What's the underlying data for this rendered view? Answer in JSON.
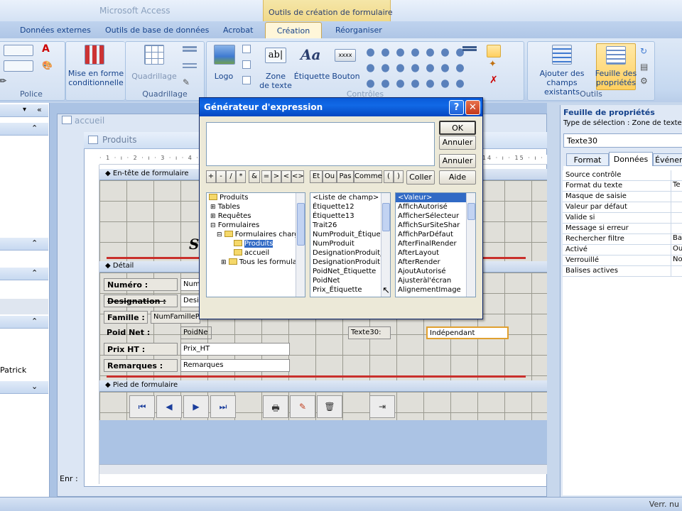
{
  "app": {
    "title": "Microsoft Access",
    "contextual_group": "Outils de création de formulaire"
  },
  "ribbon": {
    "tabs": [
      "Données externes",
      "Outils de base de données",
      "Acrobat",
      "Création",
      "Réorganiser"
    ],
    "active_tab": "Création",
    "groups": {
      "police": "Police",
      "mise_en_forme": "Mise en forme\nconditionnelle",
      "quadrillage_btn": "Quadrillage",
      "quadrillage": "Quadrillage",
      "logo": "Logo",
      "zone_de_texte": "Zone\nde texte",
      "etiquette": "Étiquette",
      "bouton": "Bouton",
      "controles": "Contrôles",
      "ajouter_champs": "Ajouter des\nchamps existants",
      "feuille_proprietes": "Feuille des\npropriétés",
      "outils": "Outils"
    }
  },
  "navpane": {
    "item_patrick": "Patrick"
  },
  "tabs": {
    "accueil": "accueil",
    "produits": "Produits"
  },
  "form": {
    "ruler": "· 1 · ı · 2 · ı · 3 · ı · 4 · ı · 5 · ı · 6 · ı · 7 · ı · 8 · ı · 9 · ı · 10 · ı · 11 · ı · 12 · ı · 13 · ı · 14 · ı · 15 · ı · 16 · ı",
    "sections": {
      "header": "En-tête de formulaire",
      "detail": "Détail",
      "footer": "Pied de formulaire"
    },
    "fields": [
      {
        "label": "Numéro :",
        "control": "Num"
      },
      {
        "label": "Designation :",
        "control": "Desi"
      },
      {
        "label": "Famille :",
        "control": "NumFamilleP"
      },
      {
        "label": "Poid Net :",
        "control": "PoidNe"
      },
      {
        "label": "Prix HT :",
        "control": "Prix_HT"
      },
      {
        "label": "Remarques :",
        "control": "Remarques"
      }
    ],
    "texte30_label": "Texte30:",
    "independant": "Indépendant",
    "nav_buttons": [
      "⏮",
      "◀",
      "▶",
      "⏭"
    ]
  },
  "dialog": {
    "title": "Générateur d'expression",
    "expression": "",
    "buttons": {
      "ok": "OK",
      "annuler1": "Annuler",
      "annuler2": "Annuler",
      "coller": "Coller",
      "aide": "Aide"
    },
    "operators": [
      "+",
      "-",
      "/",
      "*",
      "&",
      "=",
      ">",
      "<",
      "<>",
      "Et",
      "Ou",
      "Pas",
      "Comme",
      "(",
      ")"
    ],
    "tree": [
      "Produits",
      "Tables",
      "Requêtes",
      "Formulaires",
      "Formulaires charg",
      "Produits",
      "accueil",
      "Tous les formulair"
    ],
    "middle_list": [
      "<Liste de champ>",
      "Étiquette12",
      "Étiquette13",
      "Trait26",
      "NumProduit_Étiquet",
      "NumProduit",
      "DesignationProduit_",
      "DesignationProduit",
      "PoidNet_Étiquette",
      "PoidNet",
      "Prix_Étiquette"
    ],
    "right_list": [
      "<Valeur>",
      "AffichAutorisé",
      "AfficherSélecteur",
      "AffichSurSiteShar",
      "AffichParDéfaut",
      "AfterFinalRender",
      "AfterLayout",
      "AfterRender",
      "AjoutAutorisé",
      "Ajusteràl'écran",
      "AlignementImage"
    ]
  },
  "properties": {
    "title": "Feuille de propriétés",
    "selection_type": "Type de sélection :  Zone de texte",
    "selected": "Texte30",
    "tabs": [
      "Format",
      "Données",
      "Événem"
    ],
    "active_tab": "Données",
    "rows": [
      {
        "name": "Source contrôle",
        "value": ""
      },
      {
        "name": "Format du texte",
        "value": "Te"
      },
      {
        "name": "Masque de saisie",
        "value": ""
      },
      {
        "name": "Valeur par défaut",
        "value": ""
      },
      {
        "name": "Valide si",
        "value": ""
      },
      {
        "name": "Message si erreur",
        "value": ""
      },
      {
        "name": "Rechercher filtre",
        "value": "Ba"
      },
      {
        "name": "Activé",
        "value": "Ou"
      },
      {
        "name": "Verrouillé",
        "value": "No"
      },
      {
        "name": "Balises actives",
        "value": ""
      }
    ]
  },
  "status": {
    "right": "Verr. nu",
    "record_label": "Enr :"
  }
}
